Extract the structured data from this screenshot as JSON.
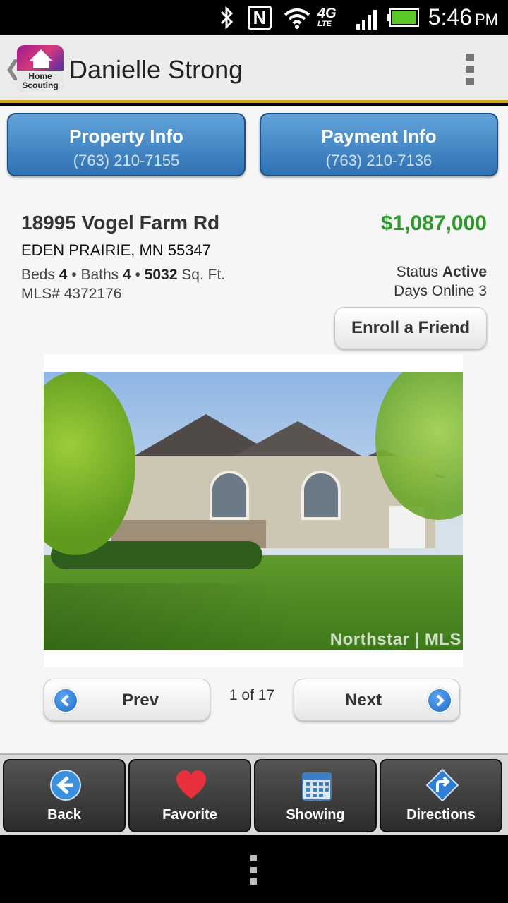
{
  "status_bar": {
    "time": "5:46",
    "ampm": "PM",
    "network_label": "4G",
    "network_sub": "LTE",
    "nfc_label": "N",
    "icons": [
      "bluetooth-icon",
      "nfc-icon",
      "wifi-icon",
      "lte-icon",
      "signal-icon",
      "battery-icon"
    ]
  },
  "action_bar": {
    "title": "Danielle Strong",
    "logo_line1": "Home",
    "logo_line2": "Scouting",
    "back_glyph": "❮"
  },
  "info_buttons": [
    {
      "label": "Property Info",
      "phone": "(763) 210-7155"
    },
    {
      "label": "Payment Info",
      "phone": "(763) 210-7136"
    }
  ],
  "listing": {
    "address": "18995 Vogel Farm Rd",
    "city_line": "EDEN PRAIRIE, MN 55347",
    "price": "$1,087,000",
    "beds_label": "Beds",
    "beds": "4",
    "baths_label": "Baths",
    "baths": "4",
    "sqft": "5032",
    "sqft_label": "Sq. Ft.",
    "mls": "MLS# 4372176",
    "status_label": "Status",
    "status_value": "Active",
    "days_online": "Days Online 3",
    "enroll_label": "Enroll a Friend"
  },
  "photo": {
    "watermark": "Northstar | MLS"
  },
  "pager": {
    "prev_label": "Prev",
    "next_label": "Next",
    "position": "1 of 17"
  },
  "toolbar": [
    {
      "label": "Back",
      "icon": "back-arrow-icon"
    },
    {
      "label": "Favorite",
      "icon": "heart-icon"
    },
    {
      "label": "Showing",
      "icon": "calendar-icon"
    },
    {
      "label": "Directions",
      "icon": "directions-icon"
    }
  ],
  "colors": {
    "accent_blue": "#2f72b4",
    "price_green": "#2b9a2b",
    "actionbar_underline": "#e0a21a"
  }
}
